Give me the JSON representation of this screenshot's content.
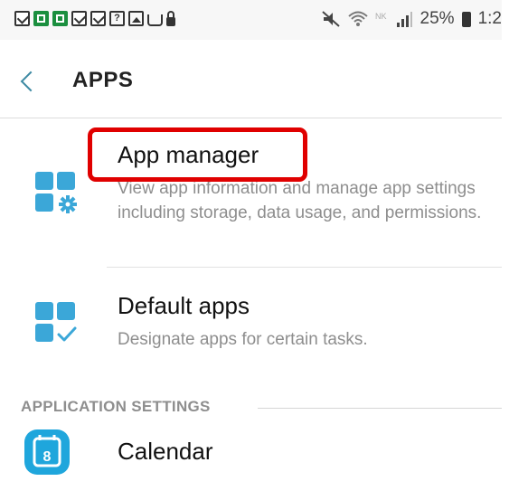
{
  "status_bar": {
    "battery_percent": "25%",
    "time": "1:2"
  },
  "header": {
    "title": "APPS"
  },
  "items": [
    {
      "title": "App manager",
      "description": "View app information and manage app settings including storage, data usage, and permissions."
    },
    {
      "title": "Default apps",
      "description": "Designate apps for certain tasks."
    }
  ],
  "section": {
    "label": "APPLICATION SETTINGS"
  },
  "settings_items": [
    {
      "title": "Calendar",
      "icon_text": "8"
    }
  ],
  "colors": {
    "accent": "#3d8aa3",
    "icon_blue": "#3ba7d8",
    "calendar_blue": "#1fa6dc",
    "highlight": "#e00000"
  }
}
